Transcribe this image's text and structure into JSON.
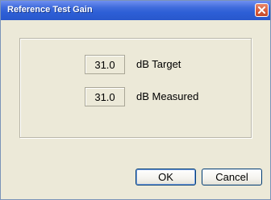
{
  "window": {
    "title": "Reference Test Gain"
  },
  "rows": [
    {
      "value": "31.0",
      "label": "dB Target"
    },
    {
      "value": "31.0",
      "label": "dB Measured"
    }
  ],
  "buttons": {
    "ok_label": "OK",
    "cancel_label": "Cancel"
  },
  "colors": {
    "titlebar": "#2d5fd6",
    "dialog_bg": "#ece9d8",
    "close_button": "#d55a3a"
  },
  "icons": {
    "close": "close-icon"
  }
}
